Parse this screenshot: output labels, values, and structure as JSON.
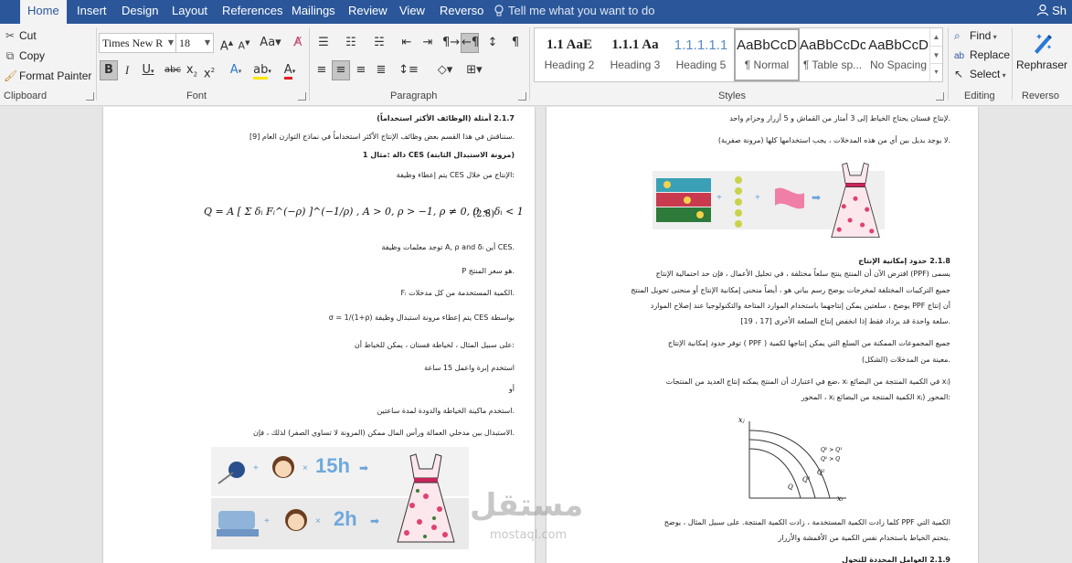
{
  "tabs": [
    "Home",
    "Insert",
    "Design",
    "Layout",
    "References",
    "Mailings",
    "Review",
    "View",
    "Reverso"
  ],
  "tellme": "Tell me what you want to do",
  "share": "Sh",
  "clipboard": {
    "cut": "Cut",
    "copy": "Copy",
    "format_painter": "Format Painter",
    "group": "Clipboard"
  },
  "font": {
    "name": "Times New R",
    "size": "18",
    "group": "Font"
  },
  "paragraph": {
    "group": "Paragraph"
  },
  "styles": {
    "group": "Styles",
    "items": [
      {
        "preview": "1.1 AaE",
        "name": "Heading 2"
      },
      {
        "preview": "1.1.1 Aa",
        "name": "Heading 3"
      },
      {
        "preview": "1.1.1.1.1",
        "name": "Heading 5"
      },
      {
        "preview": "AaBbCcD",
        "name": "¶ Normal"
      },
      {
        "preview": "AaBbCcDc",
        "name": "¶ Table sp..."
      },
      {
        "preview": "AaBbCcD",
        "name": "No Spacing"
      }
    ]
  },
  "editing": {
    "find": "Find",
    "replace": "Replace",
    "select": "Select",
    "group": "Editing"
  },
  "reverso": {
    "rephraser": "Rephraser",
    "group": "Reverso"
  },
  "left_page": {
    "heading": "2.1.7   أمثلة (الوظائف الأكثر استخداماً)",
    "p1": ".سنناقش في هذا القسم بعض وظائف الإنتاج الأكثر استخداماً في نماذج التوازن العام [9]",
    "sub1": "(مرونة الاستبدال الثابتة) CES دالة :مثال 1",
    "p2": ":الإنتاج من خلال CES يتم إعطاء وظيفة",
    "equation": "Q = A [ Σ δᵢ Fᵢ^(−ρ) ]^(−1/ρ) ,  A > 0, ρ > −1, ρ ≠ 0,  0 < δᵢ < 1",
    "eq_num": "(2.8)",
    "p3": ".CES أين A, ρ and δᵢ توجد معلمات وظيفة",
    "p4": ".هو سعر المنتج P",
    "p5": ".الكمية المستخدمة من كل مدخلات Fᵢ",
    "p6": "بواسطة CES يتم إعطاء مرونة استبدال وظيفة σ = 1/(1+ρ)",
    "p7": ":على سبيل المثال ، لخياطة فستان ، يمكن للخياط أن",
    "p8": "استخدم إبرة واعمل 15 ساعة",
    "p9": "أو",
    "p10": ".استخدم ماكينة الخياطة والدودة لمدة ساعتين",
    "p11": ".الاستبدال بين مدخلي العمالة ورأس المال ممكن (المرونة لا تساوي الصفر) لذلك ، فإن",
    "illus_15h": "15h",
    "illus_2h": "2h"
  },
  "right_page": {
    "p1": ".لإنتاج فستان يحتاج الخياط إلى 3 أمتار من القماش و 5 أزرار وحزام واحد",
    "p2": ".لا يوجد بديل بين أي من هذه المدخلات ، يجب استخدامها كلها (مرونة صفرية)",
    "heading": "2.1.8   حدود إمكانية الإنتاج",
    "p3": "يسمى (PPF) افترض الآن أن المنتج ينتج سلعاً مختلفة ، في تحليل الأعمال ، فإن حد احتمالية الإنتاج",
    "p4": "جميع التركيبات المختلفة لمخرجات يوضح رسم بياني هو ، أيضاً منحنى إمكانية الإنتاج أو منحنى تحويل المنتج",
    "p5": "أن إنتاج PPF يوضح ، سلعتين يمكن إنتاجهما باستخدام الموارد المتاحة والتكنولوجيا عند إصلاح الموارد",
    "p6": ".سلعة واحدة قد يزداد فقط إذا انخفض إنتاج السلعة الأخرى [17 ، 19]",
    "p7": "جميع المجموعات الممكنة من السلع التي يمكن إنتاجها لكمية ( PPF ) توفر حدود إمكانية الإنتاج",
    "p8": ".معينة من المدخلات (الشكل)",
    "p9": "(xᵢ في الكمية المنتجة من البضائع xᵢ ،ضع في اعتبارك أن المنتج يمكنه إنتاج العديد من المنتجات",
    "p10": ":المحور (xⱼ الكمية المنتجة من البضائع xⱼ ، المحور",
    "graph_y": "xⱼ",
    "graph_x": "xᵢ",
    "graph_q": "Q",
    "graph_q1": "Q¹",
    "graph_q2": "Q²",
    "graph_rel": "Q¹ > Q",
    "graph_rel2": "Q² > Q¹",
    "p11": "الكمية التي PPF كلما زادت الكمية المستخدمة ، زادت الكمية المنتجة. على سبيل المثال ، يوضح",
    "p12": ".يتحتم الخياط باستخدام نفس الكمية من الأقمشة والأزرار",
    "heading2": "2.1.9   العوامل المحددة للتحول"
  },
  "watermark": {
    "main": "مستقل",
    "sub": "mostaql.com"
  }
}
